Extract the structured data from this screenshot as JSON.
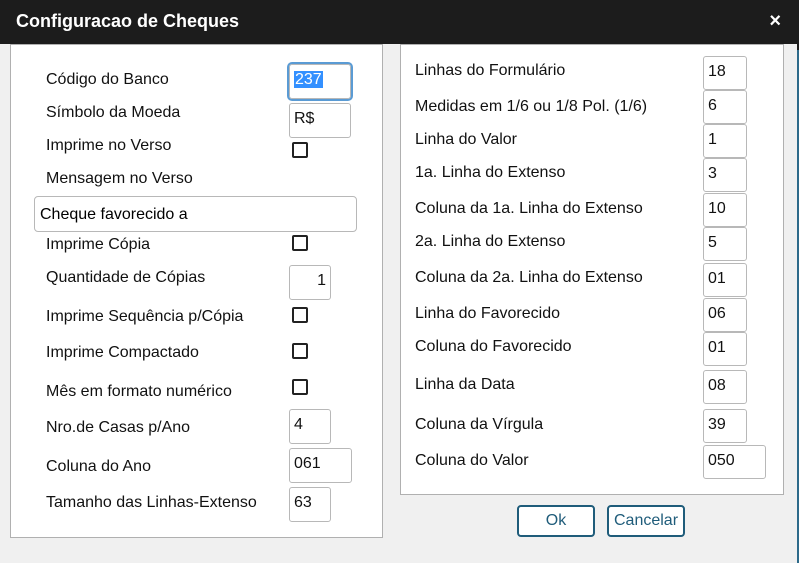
{
  "window": {
    "title": "Configuracao de Cheques",
    "close_glyph": "×"
  },
  "left": {
    "banco_label": "Código do Banco",
    "banco_value": "237",
    "moeda_label": "Símbolo da Moeda",
    "moeda_value": "R$",
    "verso_label": "Imprime no Verso",
    "msg_verso_label": "Mensagem no Verso",
    "msg_verso_value": "Cheque favorecido a",
    "copia_label": "Imprime Cópia",
    "qtd_copias_label": "Quantidade de Cópias",
    "qtd_copias_value": "1",
    "sequencia_label": "Imprime Sequência p/Cópia",
    "compactado_label": "Imprime Compactado",
    "mes_label": "Mês em formato numérico",
    "casas_ano_label": "Nro.de Casas p/Ano",
    "casas_ano_value": "4",
    "coluna_ano_label": "Coluna do Ano",
    "coluna_ano_value": "061",
    "tamanho_label": "Tamanho das Linhas-Extenso",
    "tamanho_value": "63"
  },
  "right": {
    "linhas_form_label": "Linhas do Formulário",
    "linhas_form_value": "18",
    "medidas_label": "Medidas em 1/6 ou 1/8 Pol. (1/6)",
    "medidas_value": "6",
    "linha_valor_label": "Linha do Valor",
    "linha_valor_value": "1",
    "linha1_ext_label": "1a. Linha do Extenso",
    "linha1_ext_value": "3",
    "col1_ext_label": "Coluna da 1a. Linha do Extenso",
    "col1_ext_value": "10",
    "linha2_ext_label": "2a. Linha do Extenso",
    "linha2_ext_value": "5",
    "col2_ext_label": "Coluna da 2a. Linha do Extenso",
    "col2_ext_value": "01",
    "linha_fav_label": "Linha do Favorecido",
    "linha_fav_value": "06",
    "col_fav_label": "Coluna do Favorecido",
    "col_fav_value": "01",
    "linha_data_label": "Linha da Data",
    "linha_data_value": "08",
    "col_virgula_label": "Coluna da Vírgula",
    "col_virgula_value": "39",
    "col_valor_label": "Coluna do Valor",
    "col_valor_value": "050"
  },
  "buttons": {
    "ok": "Ok",
    "cancel": "Cancelar"
  }
}
